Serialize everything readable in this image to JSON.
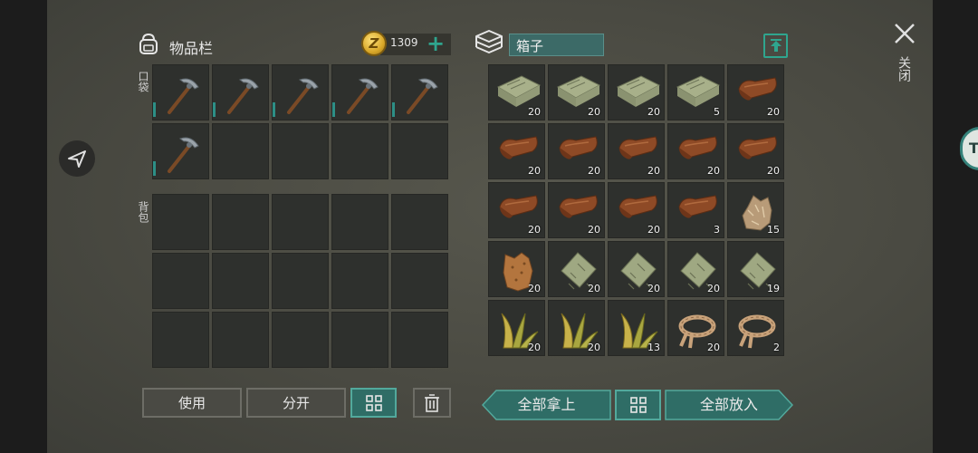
{
  "inventory": {
    "title": "物品栏",
    "coins": "1309",
    "pocket_label": "口袋",
    "backpack_label": "背包",
    "pocket_slots": [
      {
        "item": "pickaxe"
      },
      {
        "item": "pickaxe"
      },
      {
        "item": "pickaxe"
      },
      {
        "item": "pickaxe"
      },
      {
        "item": "pickaxe"
      },
      {
        "item": "pickaxe"
      },
      {
        "item": ""
      },
      {
        "item": ""
      },
      {
        "item": ""
      },
      {
        "item": ""
      }
    ],
    "backpack_slots": 15,
    "buttons": {
      "use": "使用",
      "split": "分开"
    }
  },
  "box": {
    "title": "箱子",
    "slots": [
      {
        "item": "cloth",
        "qty": "20"
      },
      {
        "item": "cloth",
        "qty": "20"
      },
      {
        "item": "cloth",
        "qty": "20"
      },
      {
        "item": "cloth",
        "qty": "5"
      },
      {
        "item": "leather",
        "qty": "20"
      },
      {
        "item": "leather",
        "qty": "20"
      },
      {
        "item": "leather",
        "qty": "20"
      },
      {
        "item": "leather",
        "qty": "20"
      },
      {
        "item": "leather",
        "qty": "20"
      },
      {
        "item": "leather",
        "qty": "20"
      },
      {
        "item": "leather",
        "qty": "20"
      },
      {
        "item": "leather",
        "qty": "20"
      },
      {
        "item": "leather",
        "qty": "20"
      },
      {
        "item": "leather",
        "qty": "3"
      },
      {
        "item": "fur",
        "qty": "15"
      },
      {
        "item": "hide",
        "qty": "20"
      },
      {
        "item": "rag",
        "qty": "20"
      },
      {
        "item": "rag",
        "qty": "20"
      },
      {
        "item": "rag",
        "qty": "20"
      },
      {
        "item": "rag",
        "qty": "19"
      },
      {
        "item": "plant-fiber",
        "qty": "20"
      },
      {
        "item": "plant-fiber",
        "qty": "20"
      },
      {
        "item": "plant-fiber",
        "qty": "13"
      },
      {
        "item": "rope",
        "qty": "20"
      },
      {
        "item": "rope",
        "qty": "2"
      }
    ],
    "buttons": {
      "take_all": "全部拿上",
      "put_all": "全部放入"
    }
  },
  "close_label": "关闭",
  "colors": {
    "accent": "#2fa58e",
    "slot_bg": "#2e302d",
    "title_bg": "#3c6a67"
  }
}
